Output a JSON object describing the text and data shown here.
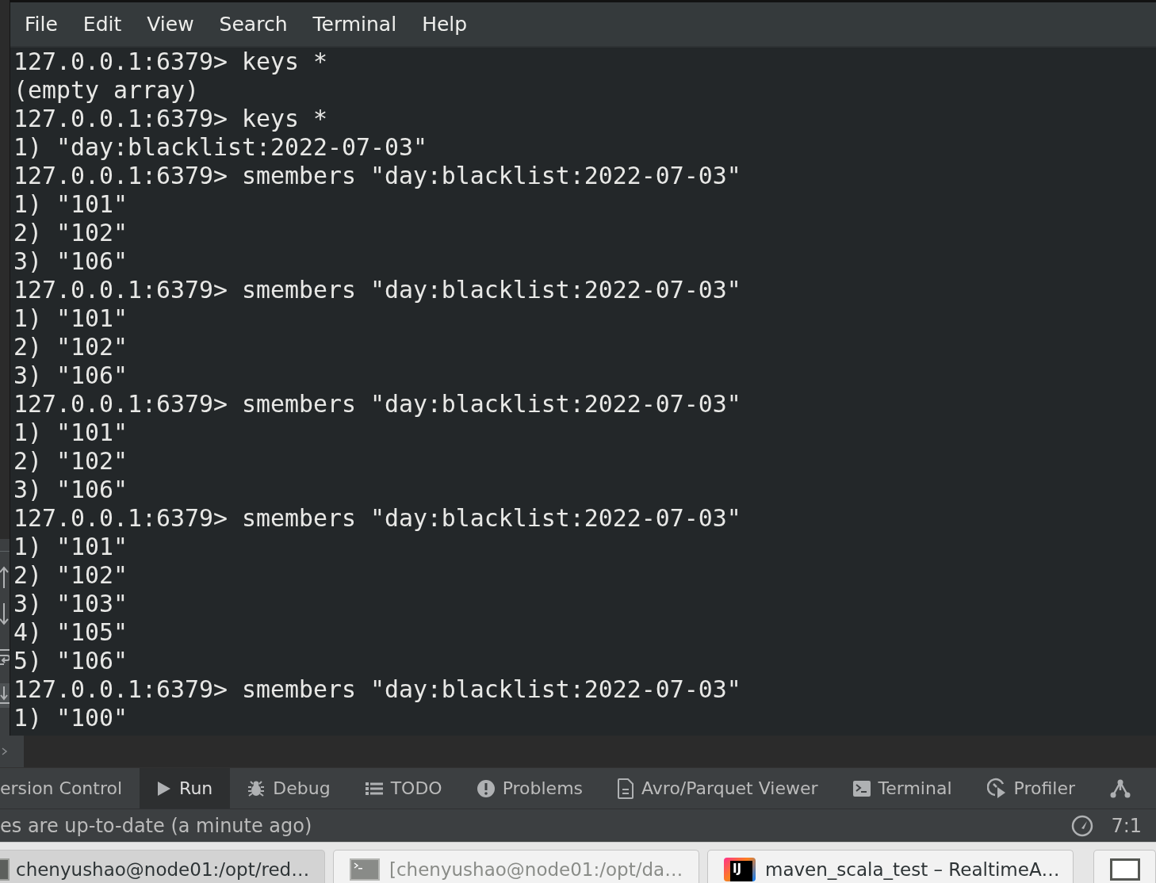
{
  "terminal_window": {
    "menu": [
      "File",
      "Edit",
      "View",
      "Search",
      "Terminal",
      "Help"
    ],
    "lines": [
      "127.0.0.1:6379> keys *",
      "(empty array)",
      "127.0.0.1:6379> keys *",
      "1) \"day:blacklist:2022-07-03\"",
      "127.0.0.1:6379> smembers \"day:blacklist:2022-07-03\"",
      "1) \"101\"",
      "2) \"102\"",
      "3) \"106\"",
      "127.0.0.1:6379> smembers \"day:blacklist:2022-07-03\"",
      "1) \"101\"",
      "2) \"102\"",
      "3) \"106\"",
      "127.0.0.1:6379> smembers \"day:blacklist:2022-07-03\"",
      "1) \"101\"",
      "2) \"102\"",
      "3) \"106\"",
      "127.0.0.1:6379> smembers \"day:blacklist:2022-07-03\"",
      "1) \"101\"",
      "2) \"102\"",
      "3) \"103\"",
      "4) \"105\"",
      "5) \"106\"",
      "127.0.0.1:6379> smembers \"day:blacklist:2022-07-03\"",
      "1) \"100\""
    ]
  },
  "tool_window_bar": {
    "tabs": [
      {
        "label": "ersion Control",
        "kind": "plain",
        "selected": false
      },
      {
        "label": "Run",
        "kind": "run",
        "selected": true
      },
      {
        "label": "Debug",
        "kind": "debug",
        "selected": false
      },
      {
        "label": "TODO",
        "kind": "todo",
        "selected": false
      },
      {
        "label": "Problems",
        "kind": "problems",
        "selected": false
      },
      {
        "label": "Avro/Parquet Viewer",
        "kind": "document",
        "selected": false
      },
      {
        "label": "Terminal",
        "kind": "terminal",
        "selected": false
      },
      {
        "label": "Profiler",
        "kind": "profiler",
        "selected": false
      },
      {
        "kind": "graph",
        "selected": false
      }
    ]
  },
  "status_bar": {
    "message": "es are up-to-date (a minute ago)",
    "position": "7:1"
  },
  "taskbar": {
    "windows": [
      {
        "title": "chenyushao@node01:/opt/red…",
        "kind": "terminal",
        "selected": true,
        "minimized": false
      },
      {
        "title": "[chenyushao@node01:/opt/da…",
        "kind": "terminal",
        "selected": false,
        "minimized": true
      },
      {
        "title": "maven_scala_test – RealtimeA…",
        "kind": "app",
        "logo_text": "IJ",
        "selected": false,
        "minimized": false
      },
      {
        "kind": "window",
        "selected": false,
        "minimized": false
      }
    ]
  }
}
